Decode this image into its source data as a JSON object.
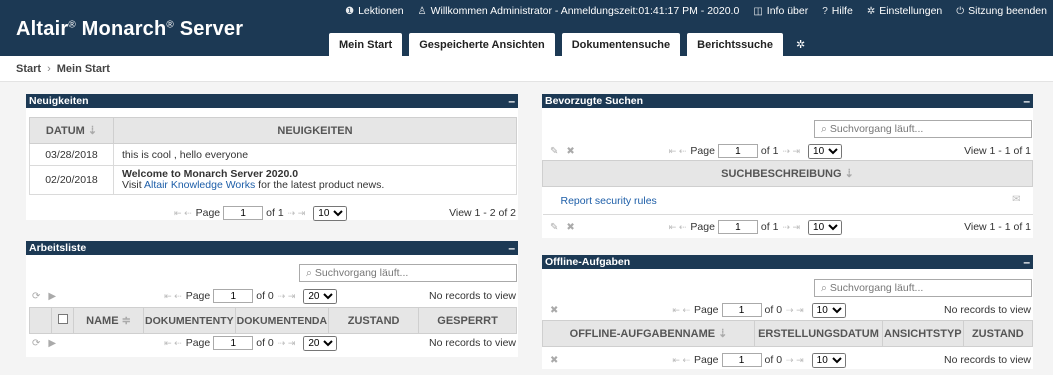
{
  "header": {
    "brand_a": "Altair",
    "brand_b": "Monarch",
    "brand_c": "Server",
    "reg": "®",
    "topnav": [
      {
        "icon": "info-icon",
        "glyph": "❶",
        "label": "Lektionen"
      },
      {
        "icon": "user-icon",
        "glyph": "♙",
        "label": "Willkommen Administrator - Anmeldungszeit:01:41:17 PM - 2020.0"
      },
      {
        "icon": "about-icon",
        "glyph": "◫",
        "label": "Info über"
      },
      {
        "icon": "help-icon",
        "glyph": "?",
        "label": "Hilfe"
      },
      {
        "icon": "settings-icon",
        "glyph": "✲",
        "label": "Einstellungen"
      },
      {
        "icon": "power-icon",
        "glyph": "⏻",
        "label": "Sitzung beenden"
      }
    ],
    "tabs": [
      "Mein Start",
      "Gespeicherte Ansichten",
      "Dokumentensuche",
      "Berichtssuche"
    ],
    "tab_gear": "✲"
  },
  "breadcrumb": {
    "home": "Start",
    "sep": "›",
    "current": "Mein Start"
  },
  "news": {
    "title": "Neuigkeiten",
    "min": "–",
    "col_date": "DATUM",
    "sort": "⇣",
    "col_news": "NEUIGKEITEN",
    "rows": [
      {
        "date": "03/28/2018",
        "text": "this is cool , hello everyone"
      },
      {
        "date": "02/20/2018",
        "title": "Welcome to Monarch Server 2020.0",
        "pre": "Visit ",
        "link": "Altair Knowledge Works",
        "post": " for the latest product news."
      }
    ],
    "pager": {
      "page_label": "Page",
      "page": "1",
      "of": "of 1",
      "size": "10",
      "view": "View 1 - 2 of 2"
    }
  },
  "worklist": {
    "title": "Arbeitsliste",
    "min": "–",
    "search_placeholder": "Suchvorgang läuft...",
    "cols": [
      "NAME",
      "DOKUMENTENTY",
      "DOKUMENTENDA",
      "ZUSTAND",
      "GESPERRT"
    ],
    "sort": "≑",
    "pager": {
      "page_label": "Page",
      "page": "1",
      "of": "of 0",
      "size": "20",
      "view": "No records to view"
    }
  },
  "favorites": {
    "title": "Bevorzugte Suchen",
    "min": "–",
    "search_placeholder": "Suchvorgang läuft...",
    "col": "SUCHBESCHREIBUNG",
    "sort": "⇣",
    "rows": [
      {
        "label": "Report security rules"
      }
    ],
    "pager": {
      "page_label": "Page",
      "page": "1",
      "of": "of 1",
      "size": "10",
      "view": "View 1 - 1 of 1"
    }
  },
  "offline": {
    "title": "Offline-Aufgaben",
    "min": "–",
    "search_placeholder": "Suchvorgang läuft...",
    "cols": [
      "OFFLINE-AUFGABENNAME",
      "ERSTELLUNGSDATUM",
      "ANSICHTSTYP",
      "ZUSTAND"
    ],
    "sort": "⇣",
    "pager": {
      "page_label": "Page",
      "page": "1",
      "of": "of 0",
      "size": "10",
      "view": "No records to view"
    }
  },
  "glyphs": {
    "first": "⇤",
    "prev": "⇠",
    "next": "⇢",
    "last": "⇥",
    "edit": "✎",
    "delete": "✖",
    "refresh": "⟳",
    "play": "▶",
    "search": "⌕",
    "mail": "✉",
    "caret": "▾"
  }
}
